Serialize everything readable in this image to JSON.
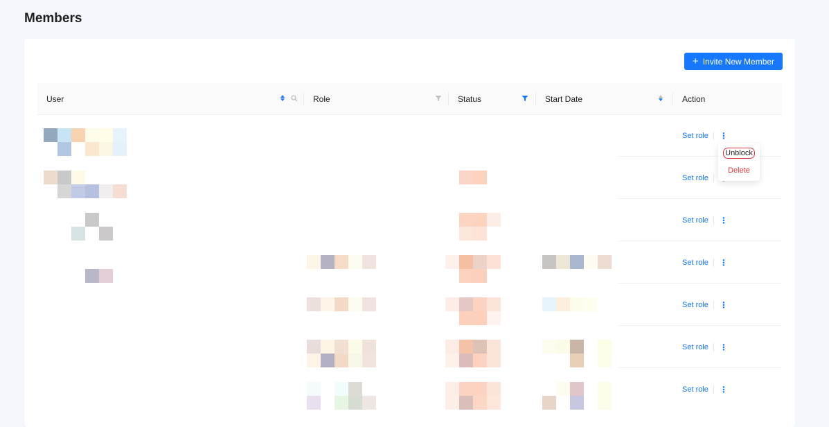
{
  "page": {
    "title": "Members"
  },
  "toolbar": {
    "invite_label": "Invite New Member"
  },
  "table": {
    "columns": [
      {
        "key": "user",
        "label": "User"
      },
      {
        "key": "role",
        "label": "Role"
      },
      {
        "key": "status",
        "label": "Status"
      },
      {
        "key": "start_date",
        "label": "Start Date"
      },
      {
        "key": "action",
        "label": "Action"
      }
    ],
    "rows": [
      {
        "action_label": "Set role"
      },
      {
        "action_label": "Set role"
      },
      {
        "action_label": "Set role"
      },
      {
        "action_label": "Set role"
      },
      {
        "action_label": "Set role"
      },
      {
        "action_label": "Set role"
      },
      {
        "action_label": "Set role"
      }
    ]
  },
  "dropdown": {
    "unblock_label": "Unblock",
    "delete_label": "Delete"
  },
  "colors": {
    "primary": "#1677ff",
    "danger": "#d9363e",
    "background": "#f4f7fc"
  },
  "icons": {
    "invite": "plus-icon",
    "sort": "sort-icon",
    "search": "search-icon",
    "filter": "filter-icon",
    "more": "more-vertical-icon"
  }
}
